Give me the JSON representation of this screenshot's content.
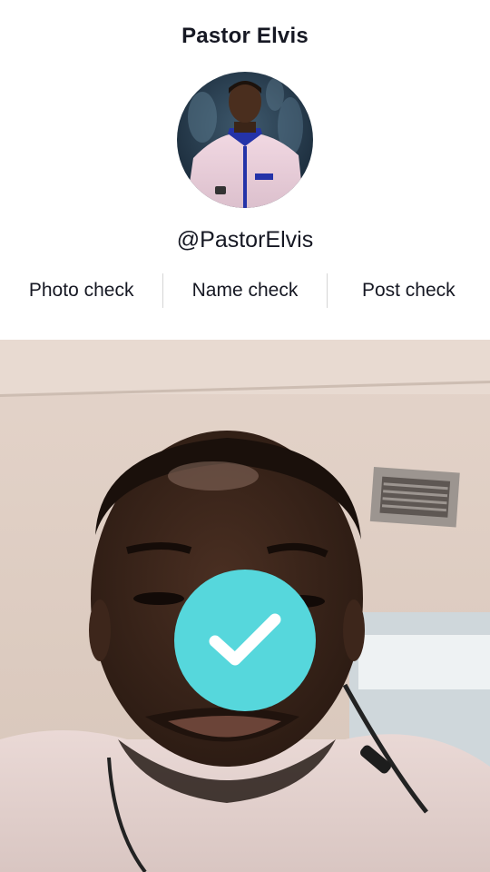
{
  "profile": {
    "name": "Pastor Elvis",
    "handle": "@PastorElvis",
    "avatar_icon": "profile-photo"
  },
  "checks": [
    {
      "label": "Photo check"
    },
    {
      "label": "Name check"
    },
    {
      "label": "Post check"
    }
  ],
  "verification": {
    "icon": "checkmark-icon",
    "badge_color": "#56d7dc"
  },
  "colors": {
    "text": "#161823",
    "divider": "#d6d6d6",
    "badge": "#56d7dc"
  }
}
